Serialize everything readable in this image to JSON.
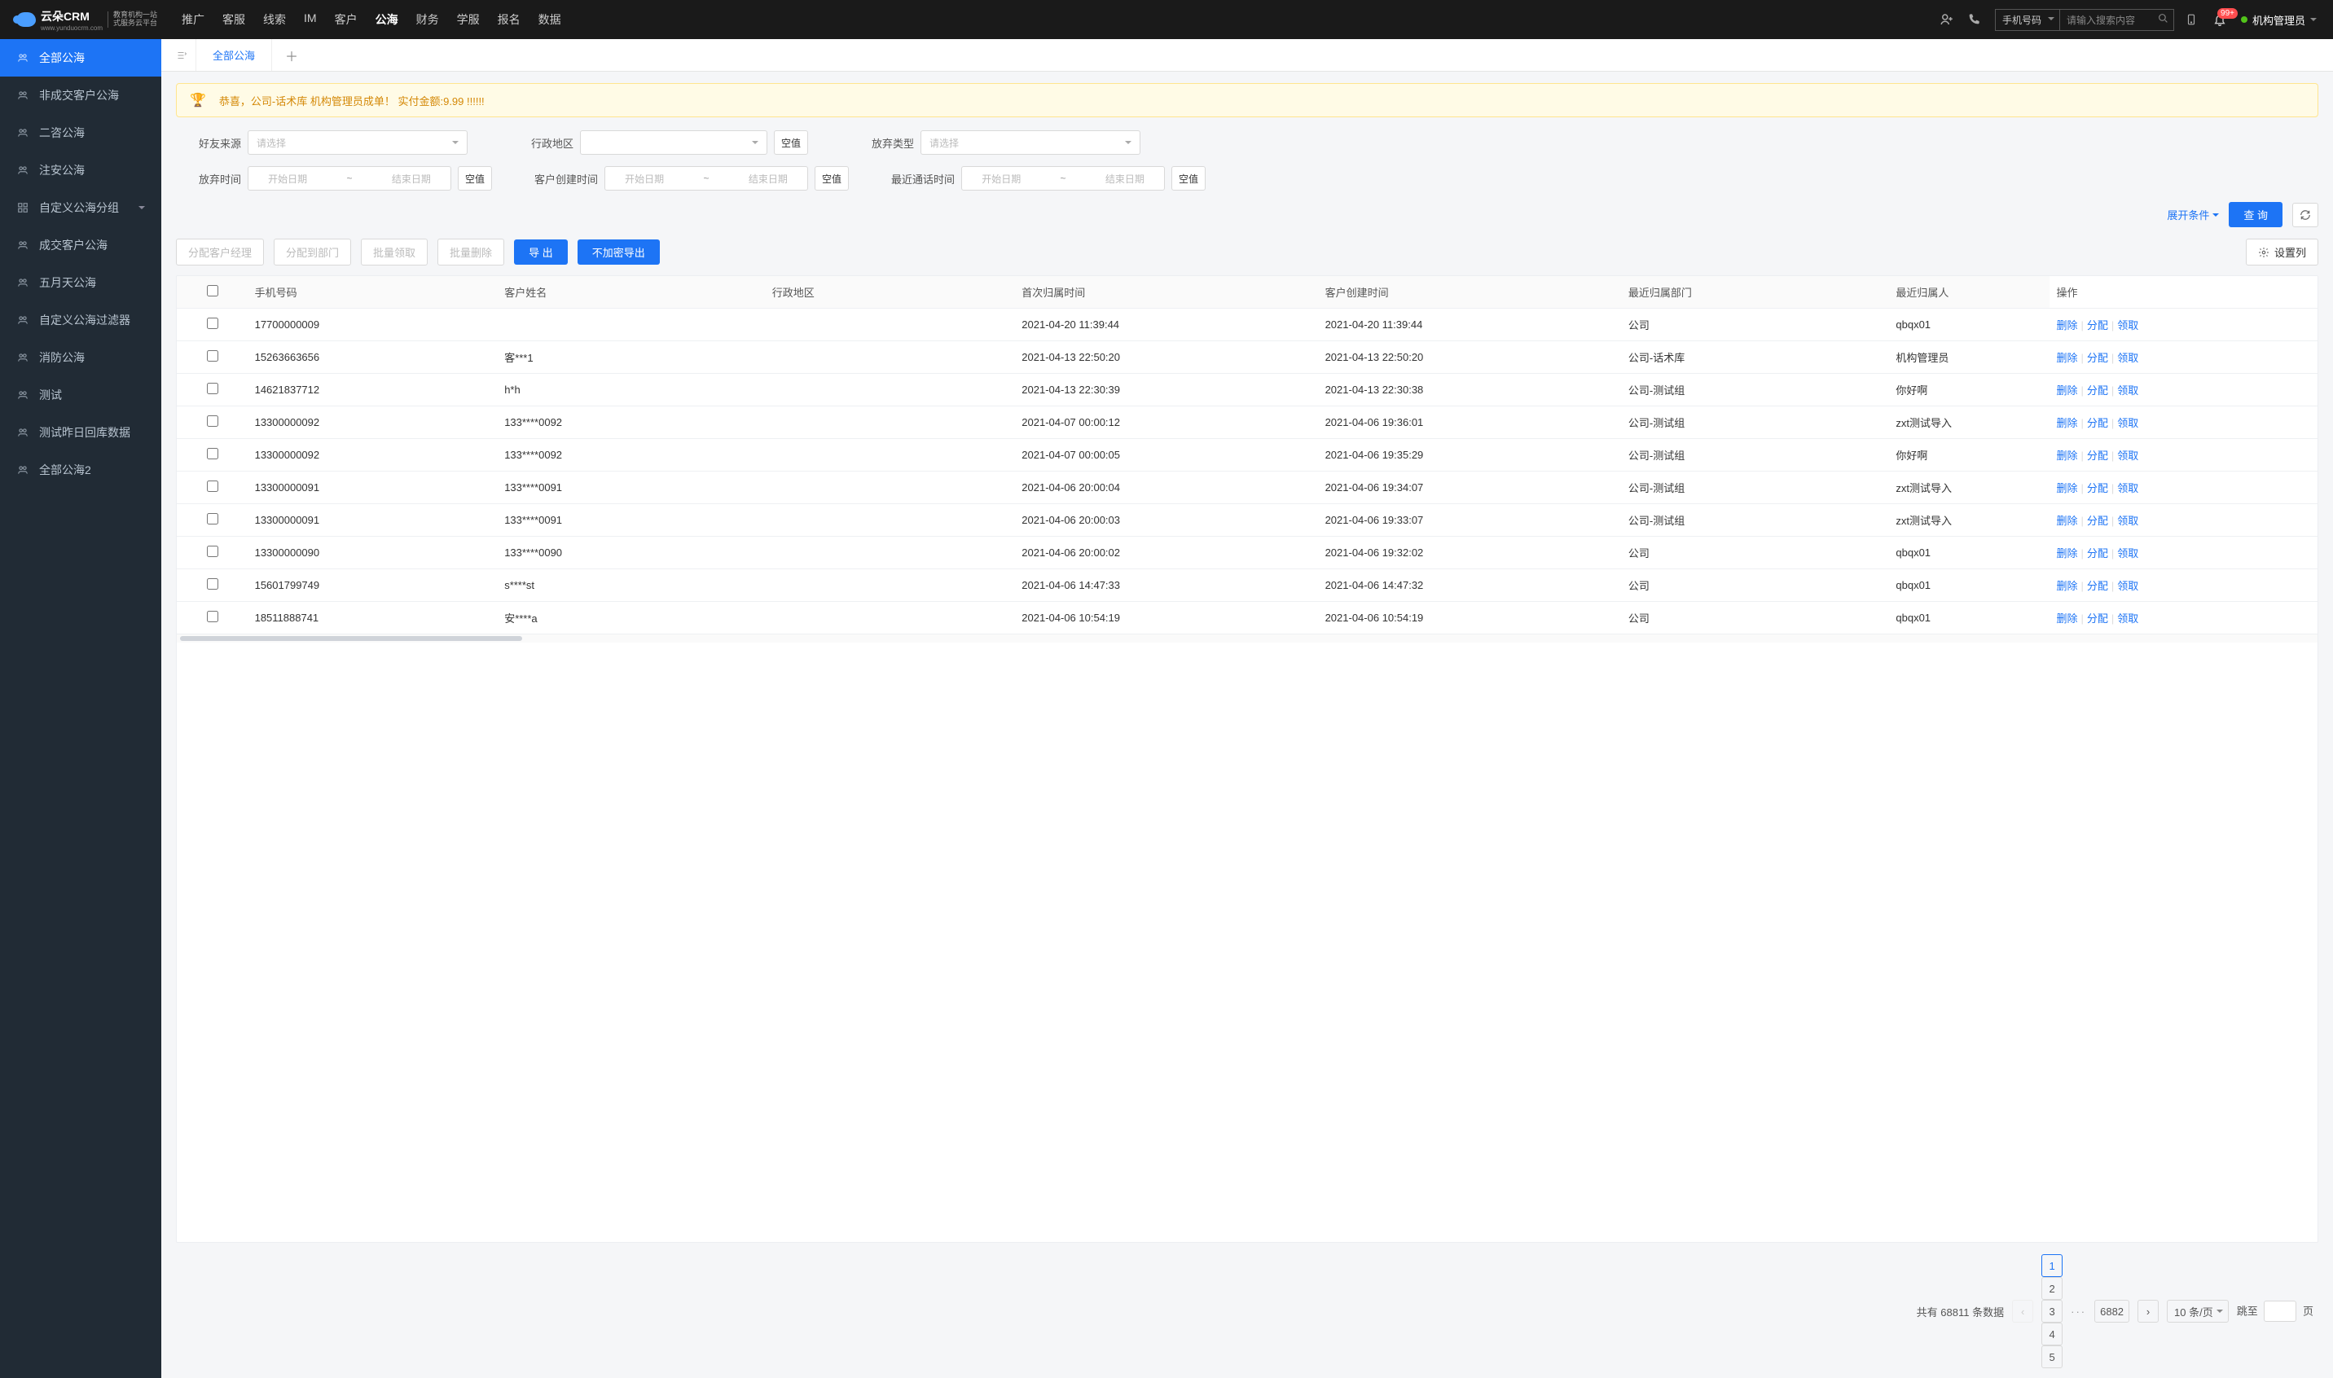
{
  "header": {
    "logo_text": "云朵CRM",
    "logo_sub1": "教育机构一站",
    "logo_sub2": "式服务云平台",
    "logo_url": "www.yunduocrm.com",
    "nav": [
      "推广",
      "客服",
      "线索",
      "IM",
      "客户",
      "公海",
      "财务",
      "学服",
      "报名",
      "数据"
    ],
    "nav_active": 5,
    "search_type": "手机号码",
    "search_placeholder": "请输入搜索内容",
    "badge": "99+",
    "user": "机构管理员"
  },
  "sidebar": {
    "items": [
      {
        "label": "全部公海",
        "active": true
      },
      {
        "label": "非成交客户公海"
      },
      {
        "label": "二咨公海"
      },
      {
        "label": "注安公海"
      },
      {
        "label": "自定义公海分组",
        "caret": true
      },
      {
        "label": "成交客户公海"
      },
      {
        "label": "五月天公海"
      },
      {
        "label": "自定义公海过滤器"
      },
      {
        "label": "消防公海"
      },
      {
        "label": "测试"
      },
      {
        "label": "测试昨日回库数据"
      },
      {
        "label": "全部公海2"
      }
    ]
  },
  "tabs": {
    "active": "全部公海"
  },
  "alert": {
    "text": "恭喜，公司-话术库  机构管理员成单！  实付金额:9.99 !!!!!!"
  },
  "filters": {
    "friend_source": {
      "label": "好友来源",
      "placeholder": "请选择"
    },
    "region": {
      "label": "行政地区",
      "null": "空值"
    },
    "abandon_type": {
      "label": "放弃类型",
      "placeholder": "请选择"
    },
    "abandon_time": {
      "label": "放弃时间",
      "start": "开始日期",
      "end": "结束日期",
      "null": "空值"
    },
    "create_time": {
      "label": "客户创建时间",
      "start": "开始日期",
      "end": "结束日期",
      "null": "空值"
    },
    "last_call": {
      "label": "最近通话时间",
      "start": "开始日期",
      "end": "结束日期",
      "null": "空值"
    },
    "expand": "展开条件",
    "query": "查 询"
  },
  "toolbar": {
    "assign_mgr": "分配客户经理",
    "assign_dept": "分配到部门",
    "batch_claim": "批量领取",
    "batch_delete": "批量删除",
    "export": "导 出",
    "export_plain": "不加密导出",
    "set_cols": "设置列"
  },
  "table": {
    "cols": [
      "手机号码",
      "客户姓名",
      "行政地区",
      "首次归属时间",
      "客户创建时间",
      "最近归属部门",
      "最近归属人",
      "操作"
    ],
    "ops": {
      "delete": "删除",
      "assign": "分配",
      "claim": "领取"
    },
    "rows": [
      {
        "phone": "17700000009",
        "name": "",
        "region": "",
        "first": "2021-04-20 11:39:44",
        "create": "2021-04-20 11:39:44",
        "dept": "公司",
        "person": "qbqx01"
      },
      {
        "phone": "15263663656",
        "name": "客***1",
        "region": "",
        "first": "2021-04-13 22:50:20",
        "create": "2021-04-13 22:50:20",
        "dept": "公司-话术库",
        "person": "机构管理员"
      },
      {
        "phone": "14621837712",
        "name": "h*h",
        "region": "",
        "first": "2021-04-13 22:30:39",
        "create": "2021-04-13 22:30:38",
        "dept": "公司-测试组",
        "person": "你好啊"
      },
      {
        "phone": "13300000092",
        "name": "133****0092",
        "region": "",
        "first": "2021-04-07 00:00:12",
        "create": "2021-04-06 19:36:01",
        "dept": "公司-测试组",
        "person": "zxt测试导入"
      },
      {
        "phone": "13300000092",
        "name": "133****0092",
        "region": "",
        "first": "2021-04-07 00:00:05",
        "create": "2021-04-06 19:35:29",
        "dept": "公司-测试组",
        "person": "你好啊"
      },
      {
        "phone": "13300000091",
        "name": "133****0091",
        "region": "",
        "first": "2021-04-06 20:00:04",
        "create": "2021-04-06 19:34:07",
        "dept": "公司-测试组",
        "person": "zxt测试导入"
      },
      {
        "phone": "13300000091",
        "name": "133****0091",
        "region": "",
        "first": "2021-04-06 20:00:03",
        "create": "2021-04-06 19:33:07",
        "dept": "公司-测试组",
        "person": "zxt测试导入"
      },
      {
        "phone": "13300000090",
        "name": "133****0090",
        "region": "",
        "first": "2021-04-06 20:00:02",
        "create": "2021-04-06 19:32:02",
        "dept": "公司",
        "person": "qbqx01"
      },
      {
        "phone": "15601799749",
        "name": "s****st",
        "region": "",
        "first": "2021-04-06 14:47:33",
        "create": "2021-04-06 14:47:32",
        "dept": "公司",
        "person": "qbqx01"
      },
      {
        "phone": "18511888741",
        "name": "安****a",
        "region": "",
        "first": "2021-04-06 10:54:19",
        "create": "2021-04-06 10:54:19",
        "dept": "公司",
        "person": "qbqx01"
      }
    ]
  },
  "pager": {
    "total_prefix": "共有",
    "total": "68811",
    "total_suffix": "条数据",
    "pages": [
      "1",
      "2",
      "3",
      "4",
      "5"
    ],
    "last": "6882",
    "size": "10 条/页",
    "jump_prefix": "跳至",
    "jump_suffix": "页"
  }
}
